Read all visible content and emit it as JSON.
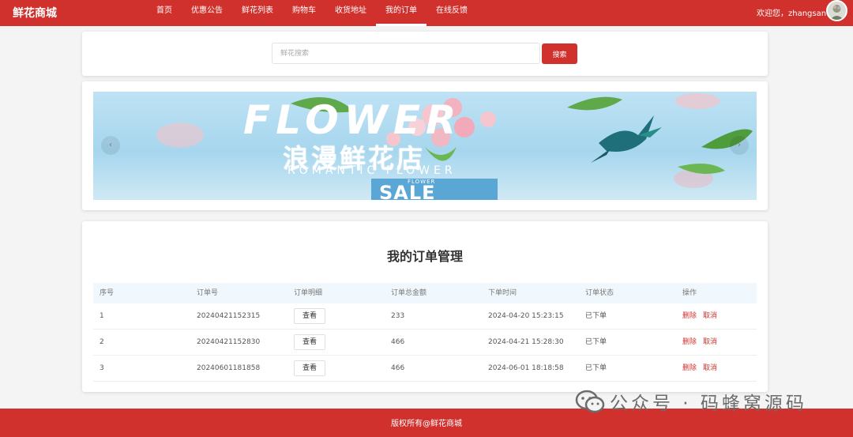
{
  "header": {
    "brand": "鲜花商城",
    "nav": [
      {
        "label": "首页",
        "active": false
      },
      {
        "label": "优惠公告",
        "active": false
      },
      {
        "label": "鲜花列表",
        "active": false
      },
      {
        "label": "购物车",
        "active": false
      },
      {
        "label": "收货地址",
        "active": false
      },
      {
        "label": "我的订单",
        "active": true
      },
      {
        "label": "在线反馈",
        "active": false
      }
    ],
    "welcome": "欢迎您，zhangsan",
    "avatar_icon": "user-avatar-icon"
  },
  "search": {
    "placeholder": "鲜花搜索",
    "value": "",
    "button_label": "搜索"
  },
  "banner": {
    "en_text": "FLOWER",
    "cn_text": "浪漫鲜花店",
    "sub_text": "ROMANTIC FLOWER",
    "small_text": "FLOWER",
    "sale_text": "SALE",
    "prev_icon": "chevron-left-icon",
    "next_icon": "chevron-right-icon",
    "prev_glyph": "‹",
    "next_glyph": "›"
  },
  "orders": {
    "title": "我的订单管理",
    "columns": [
      "序号",
      "订单号",
      "订单明细",
      "订单总金额",
      "下单时间",
      "订单状态",
      "操作"
    ],
    "view_label": "查看",
    "delete_label": "删除",
    "cancel_label": "取消",
    "rows": [
      {
        "index": "1",
        "order_no": "20240421152315",
        "amount": "233",
        "time": "2024-04-20 15:23:15",
        "status": "已下单"
      },
      {
        "index": "2",
        "order_no": "20240421152830",
        "amount": "466",
        "time": "2024-04-21 15:28:30",
        "status": "已下单"
      },
      {
        "index": "3",
        "order_no": "20240601181858",
        "amount": "466",
        "time": "2024-06-01 18:18:58",
        "status": "已下单"
      }
    ]
  },
  "footer": {
    "copyright": "版权所有@鲜花商城"
  },
  "watermark": {
    "text": "公众号 · 码蜂窝源码"
  },
  "colors": {
    "brand_red": "#d0312d",
    "table_header_bg": "#f0f8fd",
    "page_bg": "#f4f4f4"
  }
}
